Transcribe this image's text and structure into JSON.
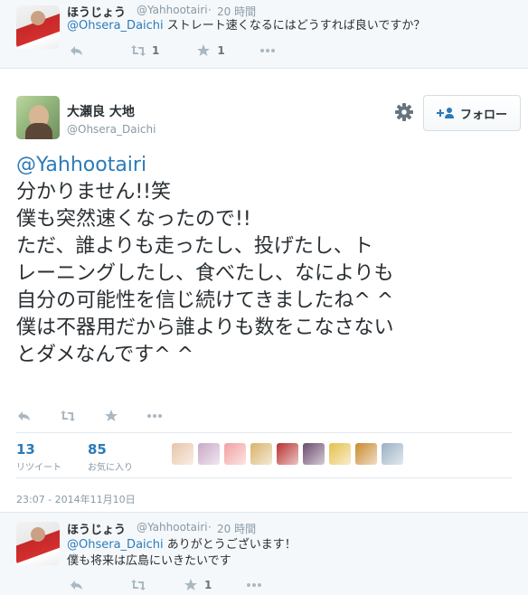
{
  "reply_top": {
    "name": "ほうじょう",
    "handle": "@Yahhootairi",
    "separator": "·",
    "time": "20 時間",
    "mention": "@Ohsera_Daichi",
    "text": "ストレート速くなるにはどうすれば良いですか？",
    "retweets": "1",
    "favorites": "1"
  },
  "main_tweet": {
    "name": "大瀬良 大地",
    "handle": "@Ohsera_Daichi",
    "follow_label": "フォロー",
    "mention": "@Yahhootairi",
    "lines": [
      "分かりません!!笑",
      "僕も突然速くなったので!!",
      "ただ、誰よりも走ったし、投げたし、ト",
      "レーニングしたし、食べたし、なによりも",
      "自分の可能性を信じ続けてきましたね^ ^",
      "僕は不器用だから誰よりも数をこなさない",
      "とダメなんです^ ^"
    ],
    "retweets_count": "13",
    "retweets_label": "リツイート",
    "favorites_count": "85",
    "favorites_label": "お気に入り",
    "timestamp": "23:07 - 2014年11月10日",
    "liker_colors": [
      "#e8c4a8",
      "#c9a9c7",
      "#f2a0a0",
      "#d8b36a",
      "#b83030",
      "#6b4a6e",
      "#e6c04a",
      "#c9892e",
      "#9bb0c4"
    ]
  },
  "reply_bottom": {
    "name": "ほうじょう",
    "handle": "@Yahhootairi",
    "separator": "·",
    "time": "20 時間",
    "mention": "@Ohsera_Daichi",
    "text_line1": "ありがとうございます！",
    "text_line2": "僕も将来は広島にいきたいです",
    "favorites": "1"
  },
  "colors": {
    "link": "#2b7bb9",
    "muted": "#8899a6",
    "reply_bg": "#f5f8fa"
  }
}
